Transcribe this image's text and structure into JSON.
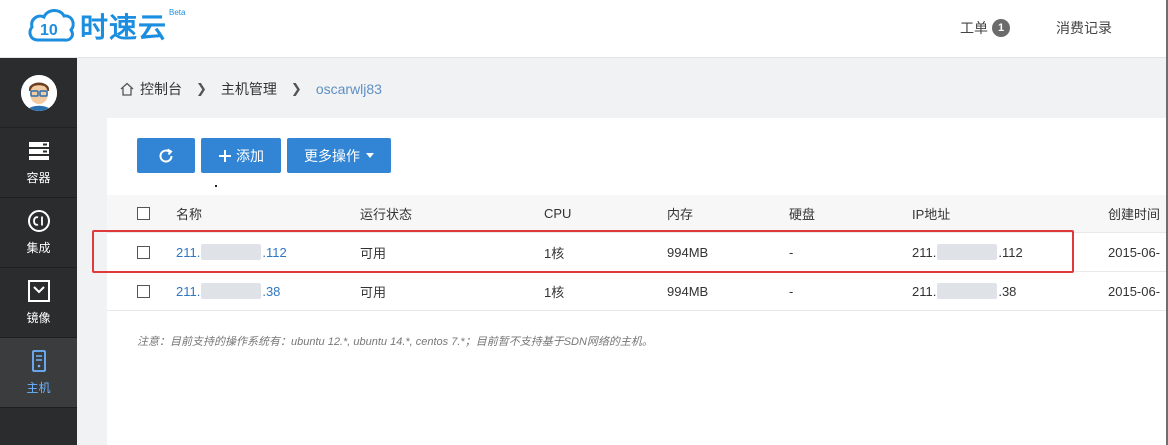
{
  "brand": {
    "name": "时速云",
    "beta": "Beta",
    "logo_mark": "10",
    "color": "#1b8ee0"
  },
  "topnav": {
    "tickets": {
      "label": "工单",
      "count": "1"
    },
    "billing": {
      "label": "消费记录"
    }
  },
  "sidebar": {
    "items": [
      {
        "label": "容器",
        "icon": "server-stack-icon"
      },
      {
        "label": "集成",
        "icon": "ci-icon"
      },
      {
        "label": "镜像",
        "icon": "image-box-icon"
      },
      {
        "label": "主机",
        "icon": "host-icon",
        "active": true
      }
    ]
  },
  "breadcrumb": {
    "items": [
      "控制台",
      "主机管理",
      "oscarwlj83"
    ]
  },
  "toolbar": {
    "add_label": "添加",
    "more_label": "更多操作"
  },
  "table": {
    "columns": [
      "名称",
      "运行状态",
      "CPU",
      "内存",
      "硬盘",
      "IP地址",
      "创建时间"
    ],
    "rows": [
      {
        "name_prefix": "211.",
        "name_suffix": ".112",
        "status": "可用",
        "cpu": "1核",
        "memory": "994MB",
        "disk": "-",
        "ip_prefix": "211.",
        "ip_suffix": ".112",
        "created": "2015-06-"
      },
      {
        "name_prefix": "211.",
        "name_suffix": ".38",
        "status": "可用",
        "cpu": "1核",
        "memory": "994MB",
        "disk": "-",
        "ip_prefix": "211.",
        "ip_suffix": ".38",
        "created": "2015-06-"
      }
    ]
  },
  "note": "注意：目前支持的操作系统有：ubuntu 12.*, ubuntu 14.*, centos 7.*；目前暂不支持基于SDN网络的主机。",
  "colors": {
    "accent": "#3285d4",
    "highlight": "#e0393c",
    "sidebar": "#2b2c2e"
  }
}
